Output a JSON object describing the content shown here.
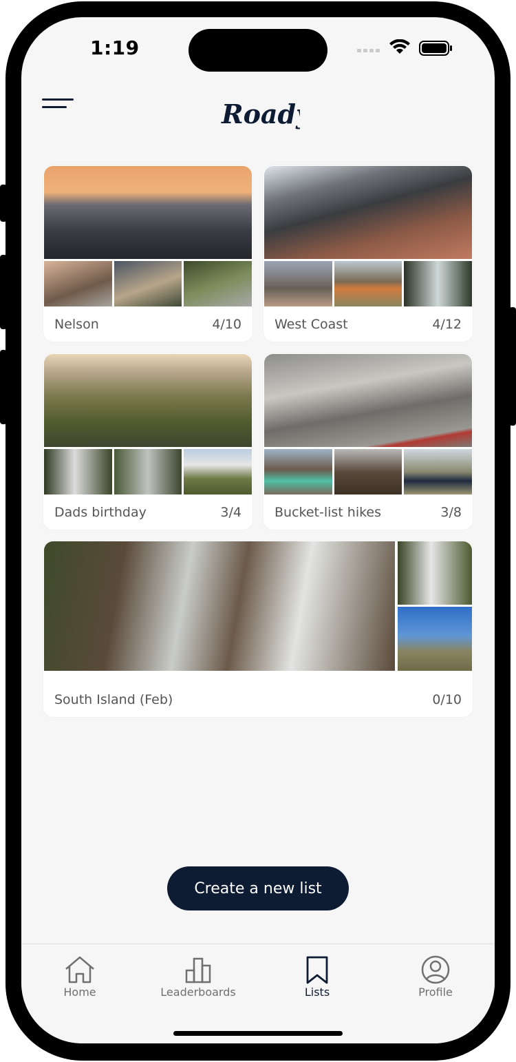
{
  "status_bar": {
    "time": "1:19"
  },
  "header": {
    "logo_text": "Roady",
    "menu_icon": "hamburger-menu-icon"
  },
  "lists": [
    {
      "name": "Nelson",
      "count": "4/10"
    },
    {
      "name": "West Coast",
      "count": "4/12"
    },
    {
      "name": "Dads birthday",
      "count": "3/4"
    },
    {
      "name": "Bucket-list hikes",
      "count": "3/8"
    },
    {
      "name": "South Island (Feb)",
      "count": "0/10"
    }
  ],
  "create_button": {
    "label": "Create a new list"
  },
  "tabbar": {
    "active": "Lists",
    "items": [
      {
        "label": "Home",
        "icon": "home-icon"
      },
      {
        "label": "Leaderboards",
        "icon": "leaderboards-icon"
      },
      {
        "label": "Lists",
        "icon": "bookmark-icon"
      },
      {
        "label": "Profile",
        "icon": "profile-icon"
      }
    ]
  },
  "colors": {
    "accent": "#0d1b33",
    "background": "#f6f6f6",
    "card": "#ffffff",
    "muted_text": "#555555"
  }
}
